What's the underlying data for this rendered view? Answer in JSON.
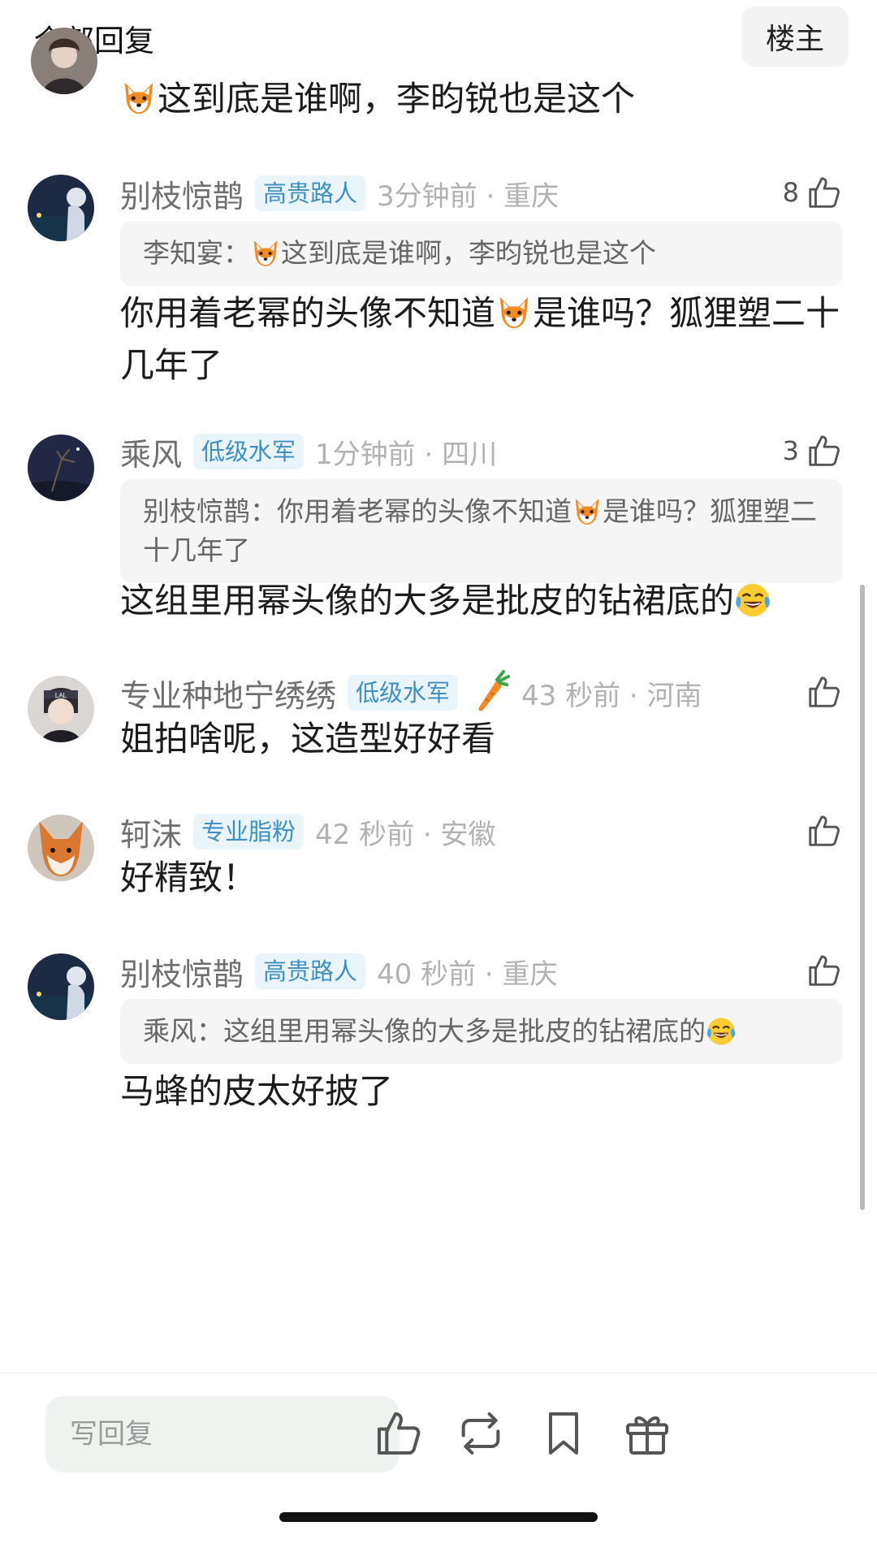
{
  "header": {
    "title": "全部回复",
    "owner_button": "楼主"
  },
  "comments": [
    {
      "body": "这到底是谁啊，李昀锐也是这个"
    },
    {
      "username": "别枝惊鹊",
      "badge": "高贵路人",
      "time": "3分钟前 · 重庆",
      "likes": "8",
      "quote_author": "李知宴：",
      "quote_text": "这到底是谁啊，李昀锐也是这个",
      "body_a": "你用着老幂的头像不知道",
      "body_b": "是谁吗？狐狸塑二十几年了"
    },
    {
      "username": "乘风",
      "badge": "低级水军",
      "time": "1分钟前 · 四川",
      "likes": "3",
      "quote_author": "别枝惊鹊：",
      "quote_a": "你用着老幂的头像不知道",
      "quote_b": "是谁吗？狐狸塑二十几年了",
      "body": "这组里用幂头像的大多是批皮的钻裙底的"
    },
    {
      "username": "专业种地宁绣绣",
      "badge": "低级水军",
      "time": "43 秒前 · 河南",
      "body": "姐拍啥呢，这造型好好看"
    },
    {
      "username": "轲沫",
      "badge": "专业脂粉",
      "time": "42 秒前 · 安徽",
      "body": "好精致！"
    },
    {
      "username": "别枝惊鹊",
      "badge": "高贵路人",
      "time": "40 秒前 · 重庆",
      "quote_author": "乘风：",
      "quote_text": "这组里用幂头像的大多是批皮的钻裙底的",
      "body": "马蜂的皮太好披了"
    }
  ],
  "bottom_bar": {
    "reply_placeholder": "写回复"
  },
  "icons": [
    "fox-emoji",
    "laugh-cry-emoji",
    "carrot-icon",
    "thumbs-up-icon",
    "repost-icon",
    "bookmark-icon",
    "gift-icon"
  ],
  "colors": {
    "badge_text": "#3d8fc4",
    "badge_bg": "#eaf4fb",
    "username": "#6f6f6f",
    "time": "#b2b2b2",
    "quote_bg": "#f5f5f5",
    "input_bg": "#eef3ef"
  }
}
